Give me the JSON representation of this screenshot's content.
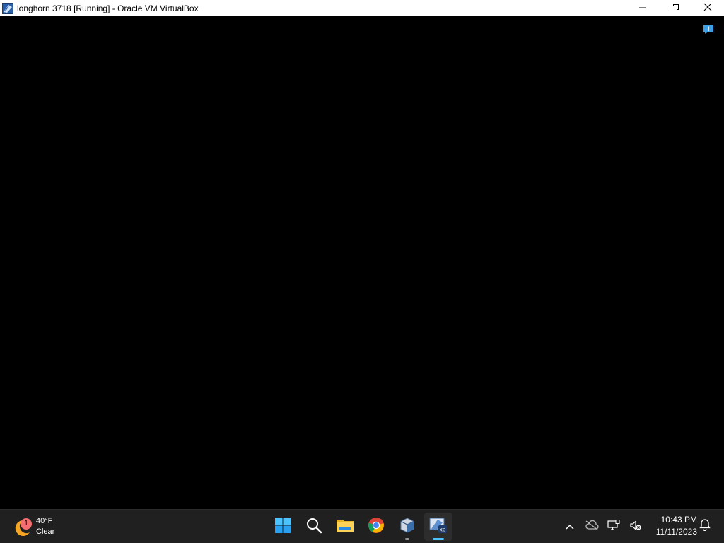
{
  "window": {
    "title": "longhorn 3718 [Running] - Oracle VM VirtualBox",
    "icon": "virtualbox-vm-icon",
    "controls": [
      "minimize-icon",
      "restore-icon",
      "close-icon"
    ]
  },
  "vm_screen": {
    "background": "#000000",
    "indicator_icon": "notification-indicator-icon"
  },
  "taskbar": {
    "weather": {
      "badge": "1",
      "temperature": "40°F",
      "condition": "Clear",
      "icon": "moon-icon"
    },
    "apps": [
      {
        "name": "start",
        "icon": "windows-start-icon"
      },
      {
        "name": "search",
        "icon": "search-icon"
      },
      {
        "name": "file-explorer",
        "icon": "folder-icon"
      },
      {
        "name": "chrome",
        "icon": "chrome-icon"
      },
      {
        "name": "virtualbox-manager",
        "icon": "virtualbox-icon"
      },
      {
        "name": "virtualbox-vm",
        "icon": "vm-xp-icon"
      }
    ],
    "tray": {
      "icons": [
        "chevron-up-icon",
        "onedrive-offline-icon",
        "network-icon",
        "volume-muted-icon"
      ],
      "time": "10:43 PM",
      "date": "11/11/2023",
      "notification_icon": "bell-icon"
    }
  },
  "colors": {
    "taskbar_bg": "#202020",
    "accent": "#4cc2ff",
    "badge": "#f36e6e"
  }
}
